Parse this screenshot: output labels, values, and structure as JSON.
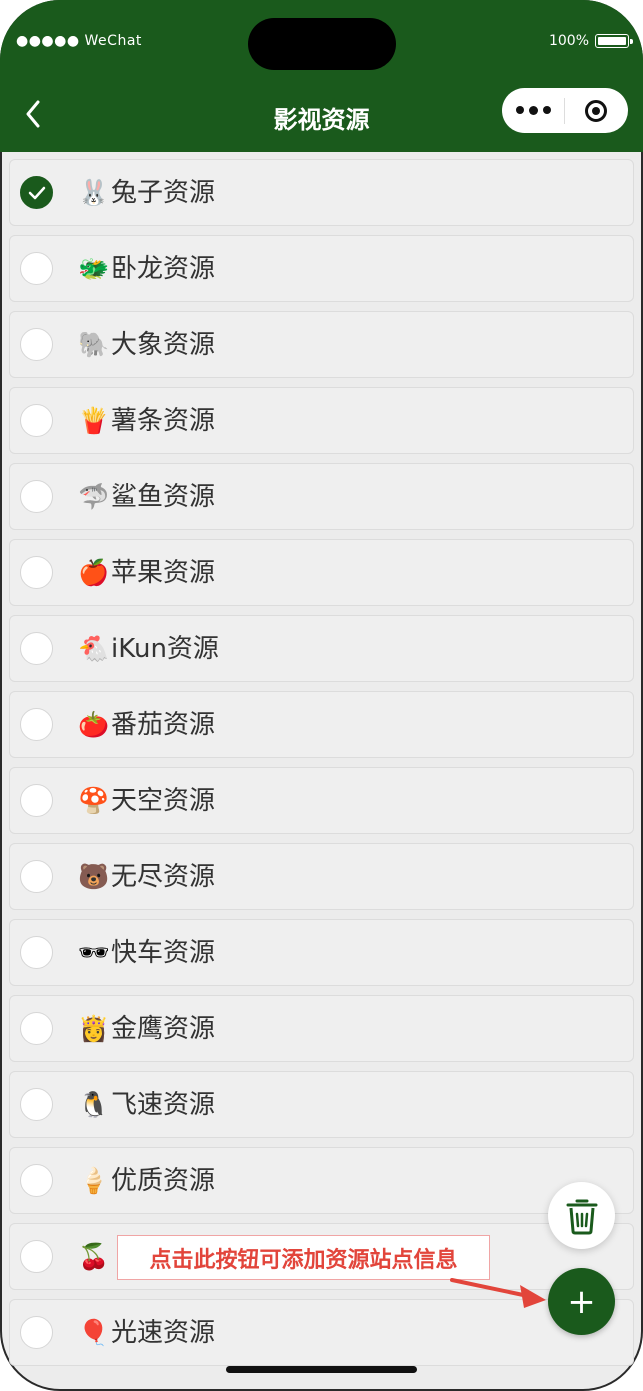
{
  "status_bar": {
    "carrier": "●●●●● WeChat",
    "battery": "100%"
  },
  "header": {
    "title": "影视资源"
  },
  "colors": {
    "accent": "#1a5a1c",
    "tip_text": "#e2453b"
  },
  "items": [
    {
      "emoji": "🐰",
      "label": "兔子资源",
      "selected": true
    },
    {
      "emoji": "🐲",
      "label": "卧龙资源",
      "selected": false
    },
    {
      "emoji": "🐘",
      "label": "大象资源",
      "selected": false
    },
    {
      "emoji": "🍟",
      "label": "薯条资源",
      "selected": false
    },
    {
      "emoji": "🦈",
      "label": "鲨鱼资源",
      "selected": false
    },
    {
      "emoji": "🍎",
      "label": "苹果资源",
      "selected": false
    },
    {
      "emoji": "🐔",
      "label": "iKun资源",
      "selected": false
    },
    {
      "emoji": "🍅",
      "label": "番茄资源",
      "selected": false
    },
    {
      "emoji": "🍄",
      "label": "天空资源",
      "selected": false
    },
    {
      "emoji": "🐻",
      "label": "无尽资源",
      "selected": false
    },
    {
      "emoji": "🕶",
      "label": "快车资源",
      "selected": false
    },
    {
      "emoji": "👸",
      "label": "金鹰资源",
      "selected": false
    },
    {
      "emoji": "🐧",
      "label": "飞速资源",
      "selected": false
    },
    {
      "emoji": "🍦",
      "label": "优质资源",
      "selected": false
    },
    {
      "emoji": "🍒",
      "label": "",
      "selected": false
    },
    {
      "emoji": "🎈",
      "label": "光速资源",
      "selected": false
    }
  ],
  "fab": {
    "add_label": "+",
    "trash_icon": "trash-icon"
  },
  "tip": {
    "text": "点击此按钮可添加资源站点信息"
  }
}
